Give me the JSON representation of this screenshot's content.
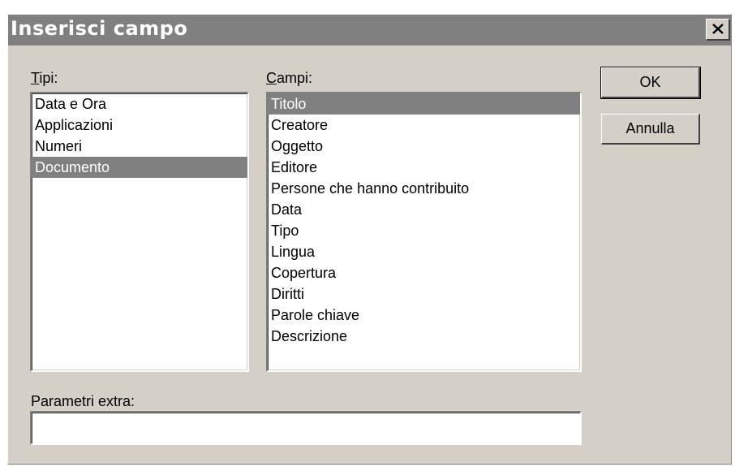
{
  "dialog": {
    "title": "Inserisci campo",
    "close_symbol": "×"
  },
  "types": {
    "label_underlined": "T",
    "label_rest": "ipi:",
    "items": [
      "Data e Ora",
      "Applicazioni",
      "Numeri",
      "Documento"
    ],
    "selected": "Documento"
  },
  "fields": {
    "label_underlined": "C",
    "label_rest": "ampi:",
    "items": [
      "Titolo",
      "Creatore",
      "Oggetto",
      "Editore",
      "Persone che hanno contribuito",
      "Data",
      "Tipo",
      "Lingua",
      "Copertura",
      "Diritti",
      "Parole chiave",
      "Descrizione"
    ],
    "selected": "Titolo"
  },
  "extra": {
    "label": "Parametri extra:",
    "value": ""
  },
  "buttons": {
    "ok": "OK",
    "cancel": "Annulla"
  },
  "colors": {
    "dialog_bg": "#d4d0c8",
    "titlebar": "#808080",
    "selection": "#808080"
  }
}
